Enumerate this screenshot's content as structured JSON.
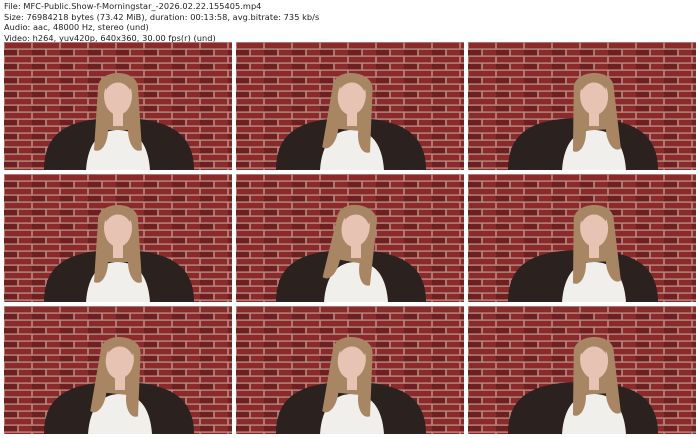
{
  "header": {
    "file_line": "File: MFC-Public.Show-f-Morningstar_-2026.02.22.155405.mp4",
    "size_line": "Size: 76984218 bytes (73.42 MiB), duration: 00:13:58, avg.bitrate: 735 kb/s",
    "audio_line": "Audio: aac, 48000 Hz, stereo (und)",
    "video_line": "Video: h264, yuv420p, 640x360, 30.00 fps(r) (und)"
  },
  "colors": {
    "brick": "#8a2a2a",
    "brick_dark": "#6e1f1f",
    "mortar": "#b78a82",
    "chair": "#2b211e",
    "shirt": "#f1efec",
    "hair": "#a88663",
    "skin": "#e6c3b2"
  },
  "thumbnails": [
    {
      "pose": "front"
    },
    {
      "pose": "down"
    },
    {
      "pose": "right"
    },
    {
      "pose": "front"
    },
    {
      "pose": "tilt"
    },
    {
      "pose": "right"
    },
    {
      "pose": "down"
    },
    {
      "pose": "down"
    },
    {
      "pose": "right"
    }
  ]
}
